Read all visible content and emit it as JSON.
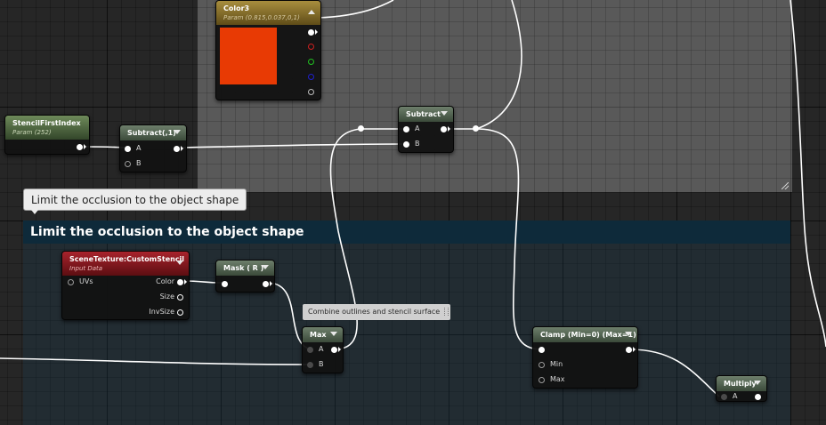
{
  "comments": {
    "tooltip": "Limit the occlusion to the object shape",
    "group_title": "Limit the occlusion to the object shape",
    "small_note": "Combine outlines and stencil surface"
  },
  "nodes": {
    "color3": {
      "title": "Color3",
      "subtitle": "Param (0.815,0.037,0,1)",
      "swatch_color": "#e83a04"
    },
    "stencil_first_index": {
      "title": "StencilFirstIndex",
      "subtitle": "Param (252)"
    },
    "subtract_1": {
      "title": "Subtract(,1)",
      "pins": [
        "A",
        "B"
      ]
    },
    "subtract": {
      "title": "Subtract",
      "pins": [
        "A",
        "B"
      ]
    },
    "scene_texture": {
      "title": "SceneTexture:CustomStencil",
      "subtitle": "Input Data",
      "inputs": [
        "UVs"
      ],
      "outputs": [
        "Color",
        "Size",
        "InvSize"
      ]
    },
    "mask": {
      "title": "Mask ( R )"
    },
    "max": {
      "title": "Max",
      "pins": [
        "A",
        "B"
      ]
    },
    "clamp": {
      "title": "Clamp (Min=0) (Max=1)",
      "pins": [
        "Min",
        "Max"
      ]
    },
    "multiply": {
      "title": "Multiply",
      "pins": [
        "A"
      ]
    }
  },
  "colors": {
    "wire": "#ffffff",
    "comment_header": "#0e2a3a",
    "param_header": "#a88e3e",
    "scene_texture_header": "#a8232c"
  }
}
